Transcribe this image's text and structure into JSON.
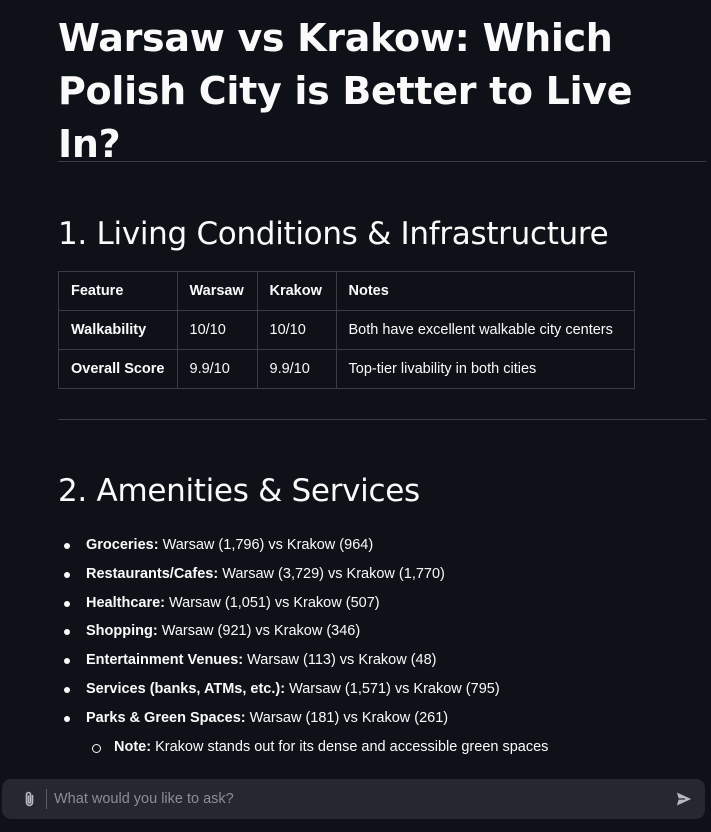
{
  "page": {
    "title": "Warsaw vs Krakow: Which Polish City is Better to Live In?"
  },
  "section1": {
    "heading": "1. Living Conditions & Infrastructure",
    "table": {
      "headers": [
        "Feature",
        "Warsaw",
        "Krakow",
        "Notes"
      ],
      "rows": [
        [
          "Walkability",
          "10/10",
          "10/10",
          "Both have excellent walkable city centers"
        ],
        [
          "Overall Score",
          "9.9/10",
          "9.9/10",
          "Top-tier livability in both cities"
        ]
      ]
    }
  },
  "section2": {
    "heading": "2. Amenities & Services",
    "items": [
      {
        "label": "Groceries:",
        "text": " Warsaw (1,796) vs Krakow (964)"
      },
      {
        "label": "Restaurants/Cafes:",
        "text": " Warsaw (3,729) vs Krakow (1,770)"
      },
      {
        "label": "Healthcare:",
        "text": " Warsaw (1,051) vs Krakow (507)"
      },
      {
        "label": "Shopping:",
        "text": " Warsaw (921) vs Krakow (346)"
      },
      {
        "label": "Entertainment Venues:",
        "text": " Warsaw (113) vs Krakow (48)"
      },
      {
        "label": "Services (banks, ATMs, etc.):",
        "text": " Warsaw (1,571) vs Krakow (795)"
      },
      {
        "label": "Parks & Green Spaces:",
        "text": " Warsaw (181) vs Krakow (261)"
      }
    ],
    "note": {
      "label": "Note:",
      "text": " Krakow stands out for its dense and accessible green spaces"
    }
  },
  "chat": {
    "placeholder": "What would you like to ask?",
    "attach_icon": "paperclip-icon",
    "send_icon": "send-icon"
  }
}
